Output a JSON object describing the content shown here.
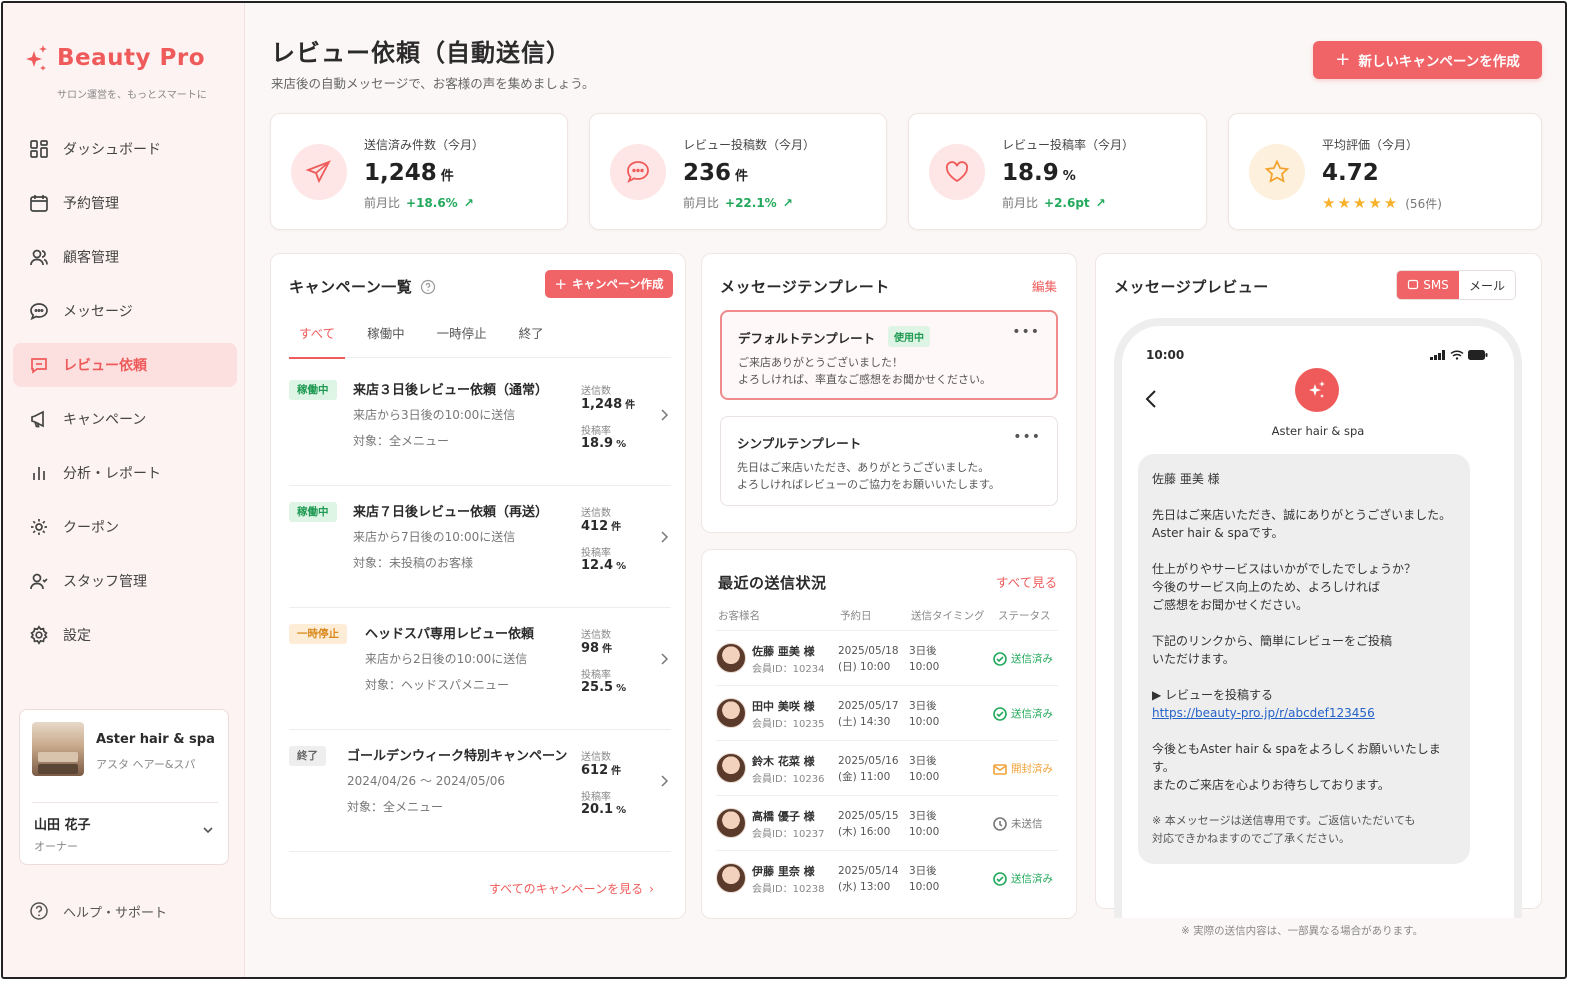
{
  "brand": {
    "name": "Beauty Pro",
    "tagline": "サロン運営を、もっとスマートに",
    "accent": "#ef5b5b"
  },
  "nav": [
    {
      "label": "ダッシュボード",
      "icon": "dashboard-icon",
      "active": false
    },
    {
      "label": "予約管理",
      "icon": "calendar-icon",
      "active": false
    },
    {
      "label": "顧客管理",
      "icon": "users-icon",
      "active": false
    },
    {
      "label": "メッセージ",
      "icon": "chat-icon",
      "active": false
    },
    {
      "label": "レビュー依頼",
      "icon": "review-icon",
      "active": true
    },
    {
      "label": "キャンペーン",
      "icon": "megaphone-icon",
      "active": false
    },
    {
      "label": "分析・レポート",
      "icon": "bar-chart-icon",
      "active": false
    },
    {
      "label": "クーポン",
      "icon": "gear-icon",
      "active": false
    },
    {
      "label": "スタッフ管理",
      "icon": "staff-icon",
      "active": false
    },
    {
      "label": "設定",
      "icon": "settings-icon",
      "active": false
    }
  ],
  "salon": {
    "name": "Aster hair & spa",
    "kana": "アスタ ヘアー&スパ"
  },
  "user": {
    "name": "山田 花子",
    "role": "オーナー"
  },
  "help": {
    "label": "ヘルプ・サポート"
  },
  "header": {
    "title": "レビュー依頼（自動送信）",
    "subtitle": "来店後の自動メッセージで、お客様の声を集めましょう。",
    "new_button": "新しいキャンペーンを作成"
  },
  "stats": [
    {
      "label": "送信済み件数（今月）",
      "value": "1,248",
      "unit": "件",
      "compare_label": "前月比",
      "change": "+18.6%",
      "icon": "send-icon"
    },
    {
      "label": "レビュー投稿数（今月）",
      "value": "236",
      "unit": "件",
      "compare_label": "前月比",
      "change": "+22.1%",
      "icon": "chat-bubble-icon"
    },
    {
      "label": "レビュー投稿率（今月）",
      "value": "18.9",
      "unit": "%",
      "compare_label": "前月比",
      "change": "+2.6pt",
      "icon": "heart-icon"
    },
    {
      "label": "平均評価（今月）",
      "value": "4.72",
      "rating": 5,
      "stars": "★★★★★",
      "count": "(56件)",
      "icon": "star-icon"
    }
  ],
  "campaigns": {
    "title": "キャンペーン一覧",
    "create_button": "キャンペーン作成",
    "tabs": [
      "すべて",
      "稼働中",
      "一時停止",
      "終了"
    ],
    "active_tab": 0,
    "items": [
      {
        "status": "稼働中",
        "status_type": "run",
        "name": "来店３日後レビュー依頼（通常）",
        "line1": "来店から3日後の10:00に送信",
        "line2": "対象：全メニュー",
        "k1": "送信数",
        "v1": "1,248",
        "u1": "件",
        "k2": "投稿率",
        "v2": "18.9",
        "u2": "%"
      },
      {
        "status": "稼働中",
        "status_type": "run",
        "name": "来店７日後レビュー依頼（再送）",
        "line1": "来店から7日後の10:00に送信",
        "line2": "対象：未投稿のお客様",
        "k1": "送信数",
        "v1": "412",
        "u1": "件",
        "k2": "投稿率",
        "v2": "12.4",
        "u2": "%"
      },
      {
        "status": "一時停止",
        "status_type": "pause",
        "name": "ヘッドスパ専用レビュー依頼",
        "line1": "来店から2日後の10:00に送信",
        "line2": "対象：ヘッドスパメニュー",
        "k1": "送信数",
        "v1": "98",
        "u1": "件",
        "k2": "投稿率",
        "v2": "25.5",
        "u2": "%"
      },
      {
        "status": "終了",
        "status_type": "end",
        "name": "ゴールデンウィーク特別キャンペーン",
        "line1": "2024/04/26 〜 2024/05/06",
        "line2": "対象：全メニュー",
        "k1": "送信数",
        "v1": "612",
        "u1": "件",
        "k2": "投稿率",
        "v2": "20.1",
        "u2": "%"
      }
    ],
    "see_all": "すべてのキャンペーンを見る"
  },
  "templates": {
    "title": "メッセージテンプレート",
    "edit": "編集",
    "items": [
      {
        "name": "デフォルトテンプレート",
        "badge": "使用中",
        "body1": "ご来店ありがとうございました！",
        "body2": "よろしければ、率直なご感想をお聞かせください。"
      },
      {
        "name": "シンプルテンプレート",
        "body1": "先日はご来店いただき、ありがとうございました。",
        "body2": "よろしければレビューのご協力をお願いいたします。"
      }
    ]
  },
  "recent": {
    "title": "最近の送信状況",
    "see_all": "すべて見る",
    "headers": [
      "お客様名",
      "予約日",
      "送信タイミング",
      "ステータス"
    ],
    "rows": [
      {
        "name": "佐藤 亜美 様",
        "id": "会員ID：10234",
        "date": "2025/05/18",
        "time": "(日) 10:00",
        "timing": "3日後",
        "timing_time": "10:00",
        "status": "送信済み",
        "status_type": "sent"
      },
      {
        "name": "田中 美咲 様",
        "id": "会員ID：10235",
        "date": "2025/05/17",
        "time": "(土) 14:30",
        "timing": "3日後",
        "timing_time": "10:00",
        "status": "送信済み",
        "status_type": "sent"
      },
      {
        "name": "鈴木 花菜 様",
        "id": "会員ID：10236",
        "date": "2025/05/16",
        "time": "(金) 11:00",
        "timing": "3日後",
        "timing_time": "10:00",
        "status": "開封済み",
        "status_type": "opened"
      },
      {
        "name": "高橋 優子 様",
        "id": "会員ID：10237",
        "date": "2025/05/15",
        "time": "(木) 16:00",
        "timing": "3日後",
        "timing_time": "10:00",
        "status": "未送信",
        "status_type": "pending"
      },
      {
        "name": "伊藤 里奈 様",
        "id": "会員ID：10238",
        "date": "2025/05/14",
        "time": "(水) 13:00",
        "timing": "3日後",
        "timing_time": "10:00",
        "status": "送信済み",
        "status_type": "sent"
      }
    ]
  },
  "preview": {
    "title": "メッセージプレビュー",
    "seg_sms": "SMS",
    "seg_mail": "メール",
    "phone_time": "10:00",
    "salon_name": "Aster hair & spa",
    "greeting": "佐藤 亜美 様",
    "p1a": "先日はご来店いただき、誠にありがとうございました。",
    "p1b": "Aster hair & spaです。",
    "p2a": "仕上がりやサービスはいかがでしたでしょうか？",
    "p2b": "今後のサービス向上のため、よろしければ",
    "p2c": "ご感想をお聞かせください。",
    "p3a": "下記のリンクから、簡単にレビューをご投稿",
    "p3b": "いただけます。",
    "p4a": "▶ レビューを投稿する",
    "link": "https://beauty-pro.jp/r/abcdef123456",
    "p5a": "今後ともAster hair & spaをよろしくお願いいたします。",
    "p5b": "またのご来店を心よりお待ちしております。",
    "note_a": "※ 本メッセージは送信専用です。ご返信いただいても",
    "note_b": "対応できかねますのでご了承ください。",
    "footer_note": "※ 実際の送信内容は、一部異なる場合があります。"
  }
}
